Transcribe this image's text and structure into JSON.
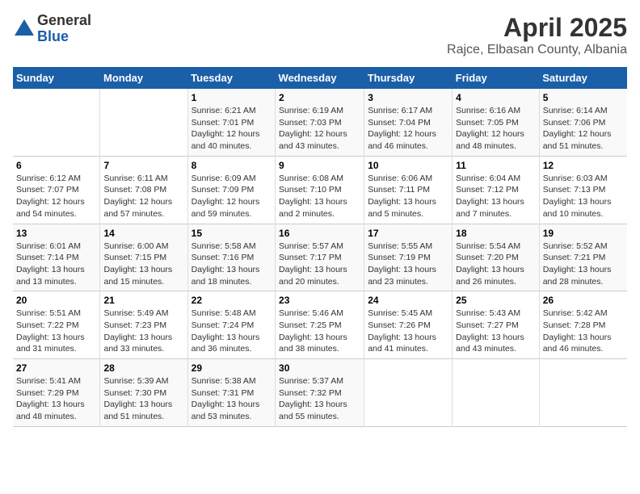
{
  "header": {
    "logo_general": "General",
    "logo_blue": "Blue",
    "title": "April 2025",
    "subtitle": "Rajce, Elbasan County, Albania"
  },
  "weekdays": [
    "Sunday",
    "Monday",
    "Tuesday",
    "Wednesday",
    "Thursday",
    "Friday",
    "Saturday"
  ],
  "weeks": [
    [
      {
        "day": "",
        "info": ""
      },
      {
        "day": "",
        "info": ""
      },
      {
        "day": "1",
        "info": "Sunrise: 6:21 AM\nSunset: 7:01 PM\nDaylight: 12 hours and 40 minutes."
      },
      {
        "day": "2",
        "info": "Sunrise: 6:19 AM\nSunset: 7:03 PM\nDaylight: 12 hours and 43 minutes."
      },
      {
        "day": "3",
        "info": "Sunrise: 6:17 AM\nSunset: 7:04 PM\nDaylight: 12 hours and 46 minutes."
      },
      {
        "day": "4",
        "info": "Sunrise: 6:16 AM\nSunset: 7:05 PM\nDaylight: 12 hours and 48 minutes."
      },
      {
        "day": "5",
        "info": "Sunrise: 6:14 AM\nSunset: 7:06 PM\nDaylight: 12 hours and 51 minutes."
      }
    ],
    [
      {
        "day": "6",
        "info": "Sunrise: 6:12 AM\nSunset: 7:07 PM\nDaylight: 12 hours and 54 minutes."
      },
      {
        "day": "7",
        "info": "Sunrise: 6:11 AM\nSunset: 7:08 PM\nDaylight: 12 hours and 57 minutes."
      },
      {
        "day": "8",
        "info": "Sunrise: 6:09 AM\nSunset: 7:09 PM\nDaylight: 12 hours and 59 minutes."
      },
      {
        "day": "9",
        "info": "Sunrise: 6:08 AM\nSunset: 7:10 PM\nDaylight: 13 hours and 2 minutes."
      },
      {
        "day": "10",
        "info": "Sunrise: 6:06 AM\nSunset: 7:11 PM\nDaylight: 13 hours and 5 minutes."
      },
      {
        "day": "11",
        "info": "Sunrise: 6:04 AM\nSunset: 7:12 PM\nDaylight: 13 hours and 7 minutes."
      },
      {
        "day": "12",
        "info": "Sunrise: 6:03 AM\nSunset: 7:13 PM\nDaylight: 13 hours and 10 minutes."
      }
    ],
    [
      {
        "day": "13",
        "info": "Sunrise: 6:01 AM\nSunset: 7:14 PM\nDaylight: 13 hours and 13 minutes."
      },
      {
        "day": "14",
        "info": "Sunrise: 6:00 AM\nSunset: 7:15 PM\nDaylight: 13 hours and 15 minutes."
      },
      {
        "day": "15",
        "info": "Sunrise: 5:58 AM\nSunset: 7:16 PM\nDaylight: 13 hours and 18 minutes."
      },
      {
        "day": "16",
        "info": "Sunrise: 5:57 AM\nSunset: 7:17 PM\nDaylight: 13 hours and 20 minutes."
      },
      {
        "day": "17",
        "info": "Sunrise: 5:55 AM\nSunset: 7:19 PM\nDaylight: 13 hours and 23 minutes."
      },
      {
        "day": "18",
        "info": "Sunrise: 5:54 AM\nSunset: 7:20 PM\nDaylight: 13 hours and 26 minutes."
      },
      {
        "day": "19",
        "info": "Sunrise: 5:52 AM\nSunset: 7:21 PM\nDaylight: 13 hours and 28 minutes."
      }
    ],
    [
      {
        "day": "20",
        "info": "Sunrise: 5:51 AM\nSunset: 7:22 PM\nDaylight: 13 hours and 31 minutes."
      },
      {
        "day": "21",
        "info": "Sunrise: 5:49 AM\nSunset: 7:23 PM\nDaylight: 13 hours and 33 minutes."
      },
      {
        "day": "22",
        "info": "Sunrise: 5:48 AM\nSunset: 7:24 PM\nDaylight: 13 hours and 36 minutes."
      },
      {
        "day": "23",
        "info": "Sunrise: 5:46 AM\nSunset: 7:25 PM\nDaylight: 13 hours and 38 minutes."
      },
      {
        "day": "24",
        "info": "Sunrise: 5:45 AM\nSunset: 7:26 PM\nDaylight: 13 hours and 41 minutes."
      },
      {
        "day": "25",
        "info": "Sunrise: 5:43 AM\nSunset: 7:27 PM\nDaylight: 13 hours and 43 minutes."
      },
      {
        "day": "26",
        "info": "Sunrise: 5:42 AM\nSunset: 7:28 PM\nDaylight: 13 hours and 46 minutes."
      }
    ],
    [
      {
        "day": "27",
        "info": "Sunrise: 5:41 AM\nSunset: 7:29 PM\nDaylight: 13 hours and 48 minutes."
      },
      {
        "day": "28",
        "info": "Sunrise: 5:39 AM\nSunset: 7:30 PM\nDaylight: 13 hours and 51 minutes."
      },
      {
        "day": "29",
        "info": "Sunrise: 5:38 AM\nSunset: 7:31 PM\nDaylight: 13 hours and 53 minutes."
      },
      {
        "day": "30",
        "info": "Sunrise: 5:37 AM\nSunset: 7:32 PM\nDaylight: 13 hours and 55 minutes."
      },
      {
        "day": "",
        "info": ""
      },
      {
        "day": "",
        "info": ""
      },
      {
        "day": "",
        "info": ""
      }
    ]
  ]
}
